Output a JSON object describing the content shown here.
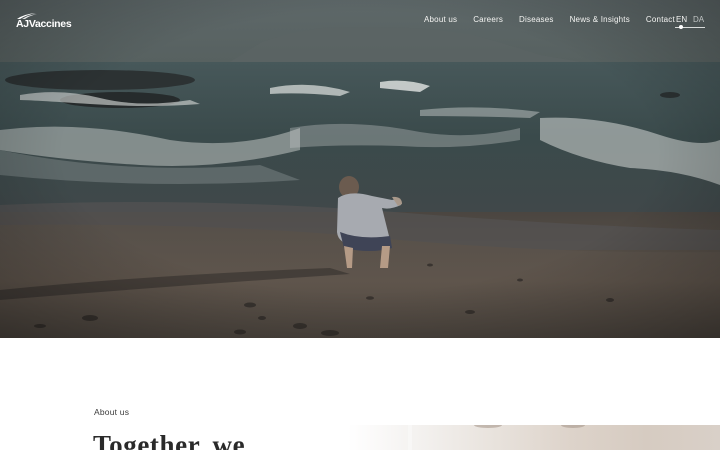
{
  "header": {
    "logo_text": "AJVaccines",
    "nav": [
      {
        "label": "About us"
      },
      {
        "label": "Careers"
      },
      {
        "label": "Diseases"
      },
      {
        "label": "News & Insights"
      },
      {
        "label": "Contact"
      }
    ],
    "language": {
      "options": [
        "EN",
        "DA"
      ],
      "selected": "EN"
    }
  },
  "about": {
    "eyebrow": "About us",
    "heading": "Together, we"
  },
  "colors": {
    "nav_text": "#f4f4f2",
    "heading_text": "#2a2a2a",
    "background": "#ffffff"
  }
}
